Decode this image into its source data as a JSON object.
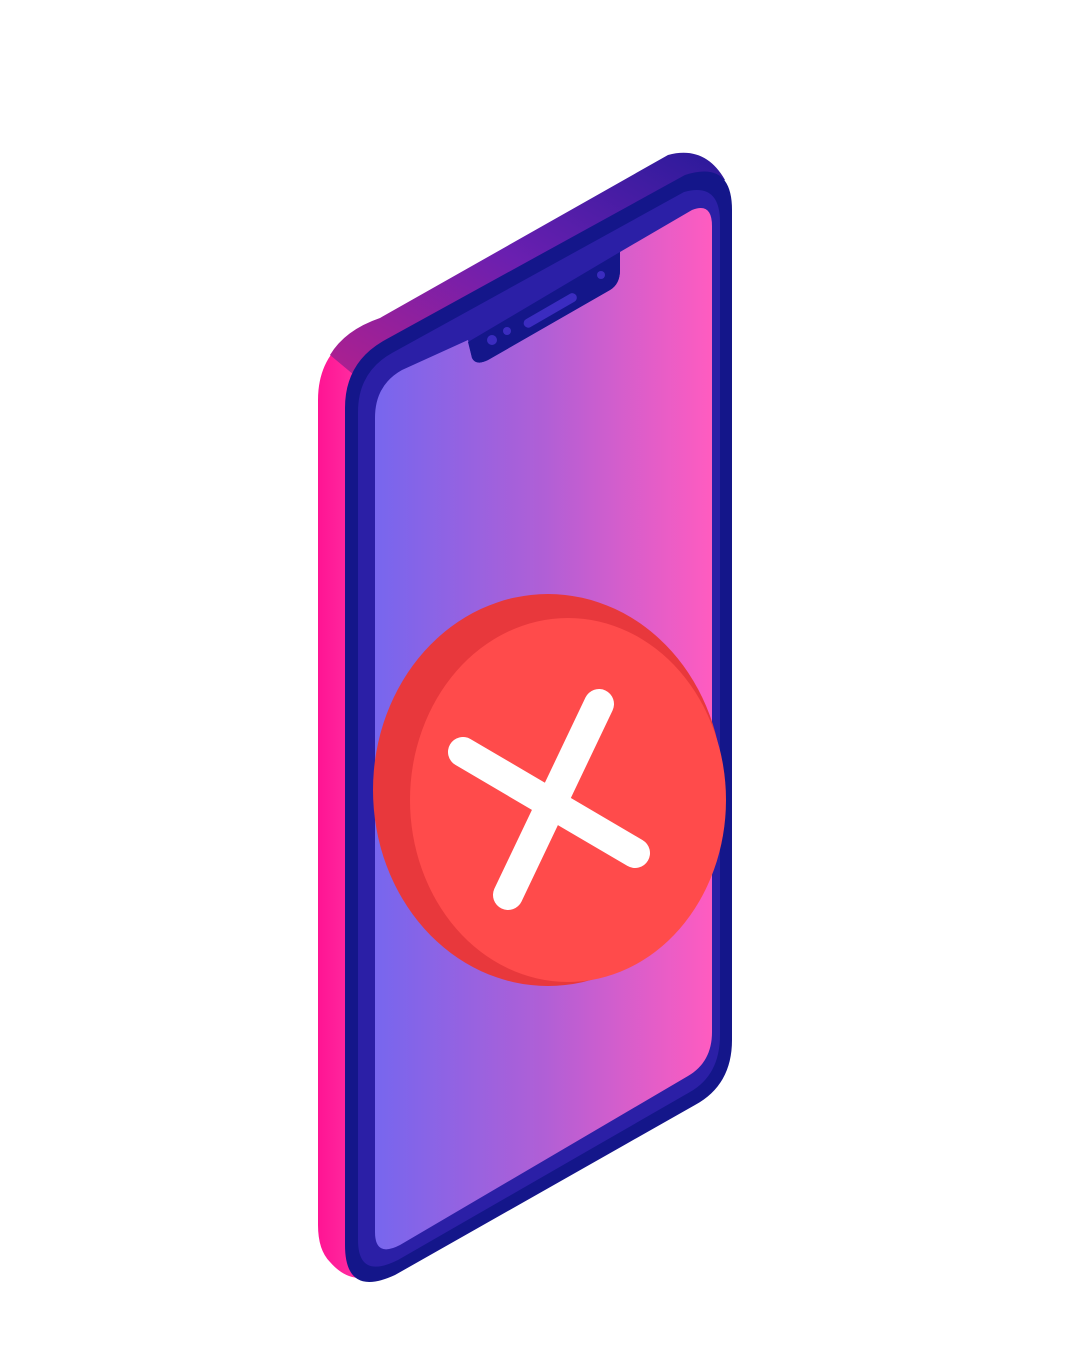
{
  "illustration": {
    "subject": "isometric-smartphone",
    "icons": [
      "smartphone-icon",
      "error-x-icon"
    ],
    "colors": {
      "background": "#ffffff",
      "phone_side_pink": "#ff1493",
      "phone_side_pink_light": "#ff4fb0",
      "phone_frame_navy": "#14168a",
      "phone_top_purple": "#6a1fb0",
      "screen_gradient_left": "#7766ee",
      "screen_gradient_mid": "#b05fd6",
      "screen_gradient_right": "#ff5cc0",
      "error_badge_red": "#ff4b4b",
      "error_badge_shadow": "#e8383c",
      "error_mark_white": "#ffffff"
    }
  }
}
